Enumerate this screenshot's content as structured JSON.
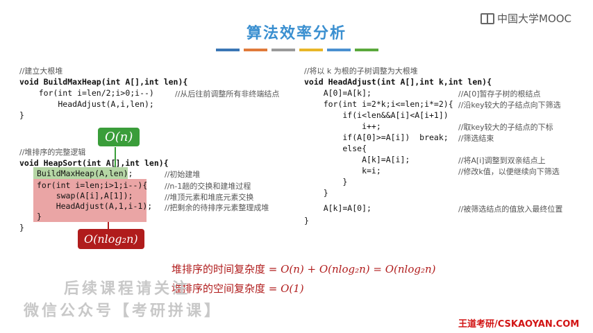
{
  "title": "算法效率分析",
  "logo": {
    "text": "中国大学MOOC",
    "icon": "book-icon"
  },
  "color_bars": [
    "#3a76b5",
    "#e07a3a",
    "#9a9a9a",
    "#e8b628",
    "#4a90d0",
    "#5aa83c"
  ],
  "left": {
    "block1": {
      "comment": "//建立大根堆",
      "sig": "void BuildMaxHeap(int A[],int len){",
      "for_line": "    for(int i=len/2;i>0;i--)",
      "for_comment": "//从后往前调整所有非终端结点",
      "call": "        HeadAdjust(A,i,len);",
      "close": "}"
    },
    "block2": {
      "comment": "//堆排序的完整逻辑",
      "sig": "void HeapSort(int A[],int len){",
      "build": "BuildMaxHeap(A,len);",
      "build_comment": "//初始建堆",
      "for_line": "for(int i=len;i>1;i--){",
      "for_comment": "//n-1趟的交换和建堆过程",
      "swap": "    swap(A[i],A[1]);",
      "swap_comment": "//堆顶元素和堆底元素交换",
      "adjust": "    HeadAdjust(A,1,i-1);",
      "adjust_comment": "//把剩余的待排序元素整理成堆",
      "inner_close": "}",
      "close": "}"
    },
    "bubble_on": "O(n)",
    "bubble_onlogn": "O(nlog₂n)"
  },
  "right": {
    "comment": "//将以 k 为根的子树调整为大根堆",
    "sig": "void HeadAdjust(int A[],int k,int len){",
    "lines": [
      {
        "code": "    A[0]=A[k];",
        "comment": "//A[0]暂存子树的根结点"
      },
      {
        "code": "    for(int i=2*k;i<=len;i*=2){",
        "comment": "//沿key较大的子结点向下筛选"
      },
      {
        "code": "        if(i<len&&A[i]<A[i+1])",
        "comment": ""
      },
      {
        "code": "            i++;",
        "comment": "//取key较大的子结点的下标"
      },
      {
        "code": "        if(A[0]>=A[i])  break;",
        "comment": "//筛选结束"
      },
      {
        "code": "        else{",
        "comment": ""
      },
      {
        "code": "            A[k]=A[i];",
        "comment": "//将A[i]调整到双亲结点上"
      },
      {
        "code": "            k=i;",
        "comment": "//修改k值，以便继续向下筛选"
      },
      {
        "code": "        }",
        "comment": ""
      },
      {
        "code": "    }",
        "comment": ""
      },
      {
        "code": "    A[k]=A[0];",
        "comment": "//被筛选结点的值放入最终位置"
      },
      {
        "code": "}",
        "comment": ""
      }
    ]
  },
  "formulas": {
    "time_label": "堆排序的时间复杂度 = ",
    "time_expr": "O(n) + O(nlog₂n) = O(nlog₂n)",
    "space_label": "堆排序的空间复杂度 = ",
    "space_expr": "O(1)"
  },
  "watermark": {
    "line1": "后续课程请关注",
    "line2": "微信公众号【考研拼课】"
  },
  "footer": "王道考研/CSKAOYAN.COM"
}
